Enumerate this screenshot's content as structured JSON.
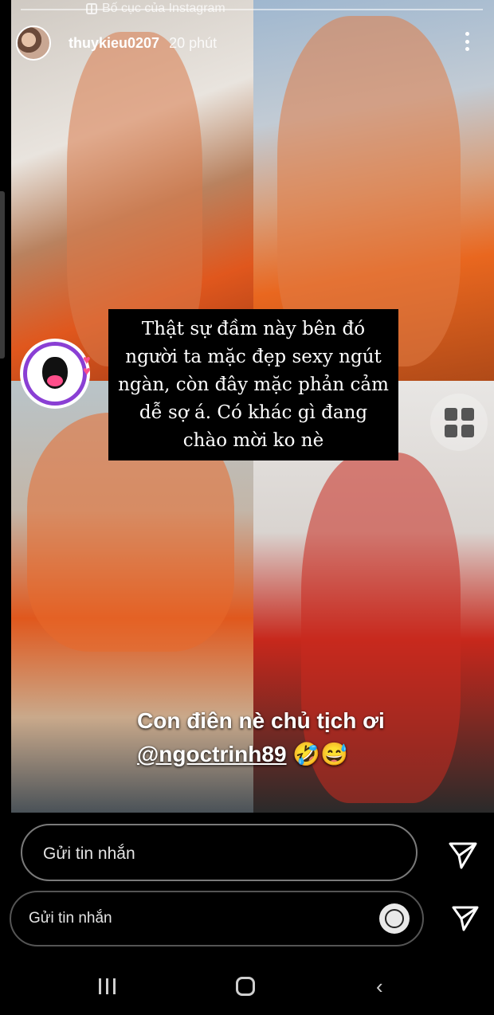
{
  "top_overlay": {
    "layout_label": "Bố cục của Instagram"
  },
  "header": {
    "username": "thuykieu0207",
    "time": "20 phút"
  },
  "caption": {
    "text": "Thật sự đầm này bên đó người ta mặc đẹp sexy ngút ngàn, còn đây mặc phản cảm dễ sợ á. Có khác gì đang chào mời ko nè"
  },
  "mention": {
    "line1": "Con điên nè chủ tịch ơi",
    "handle": "@ngoctrinh89",
    "emojis": "🤣😅"
  },
  "reply_bars": [
    {
      "placeholder": "Gửi tin nhắn"
    },
    {
      "placeholder": "Gửi tin nhắn"
    }
  ],
  "icons": {
    "more": "more-vertical-icon",
    "send": "send-icon",
    "grid": "layout-grid-icon",
    "emoji": "emoji-icon"
  },
  "colors": {
    "background": "#000000",
    "sticker_ring": "#8a3fd4"
  }
}
